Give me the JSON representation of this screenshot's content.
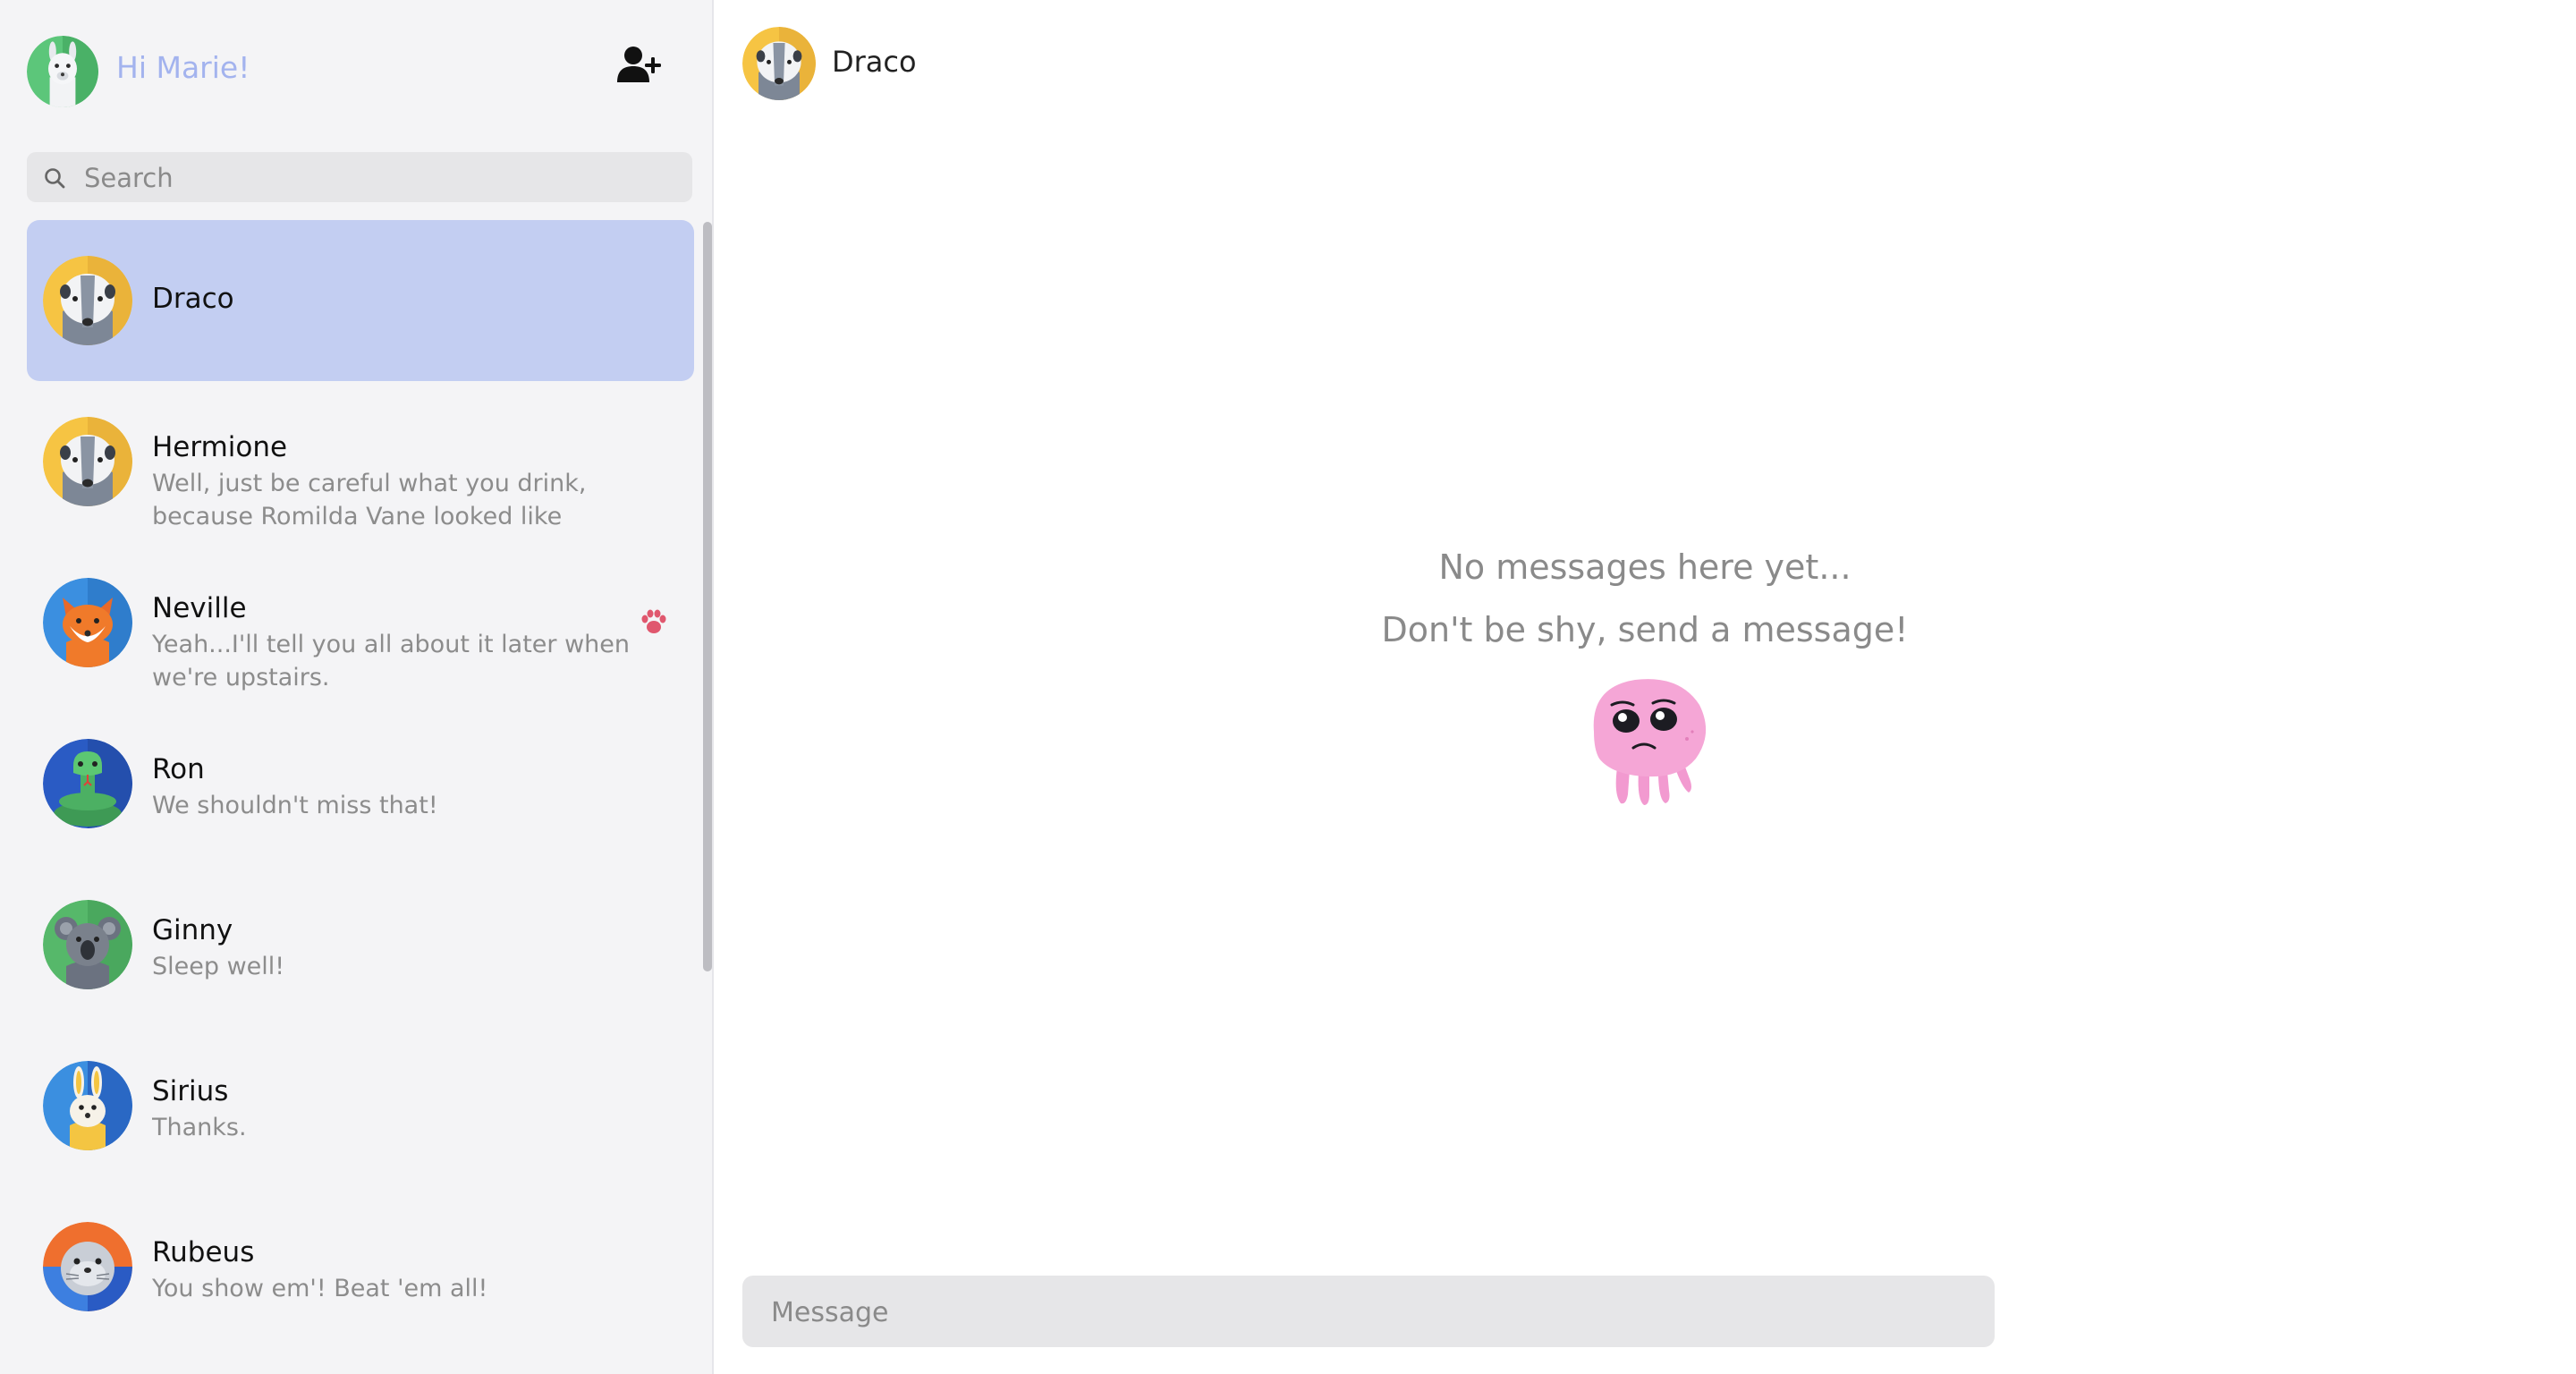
{
  "user": {
    "greeting": "Hi Marie!",
    "avatar_icon": "llama-avatar"
  },
  "sidebar": {
    "add_user_icon": "user-plus-icon",
    "search": {
      "placeholder": "Search",
      "icon": "search-icon"
    },
    "chats": [
      {
        "name": "Draco",
        "preview": "",
        "avatar_icon": "badger-avatar",
        "active": true
      },
      {
        "name": "Hermione",
        "preview": "Well, just be careful what you drink, because Romilda Vane looked like she...",
        "avatar_icon": "badger-avatar"
      },
      {
        "name": "Neville",
        "preview": "Yeah...I'll tell you all about it later when we're upstairs.",
        "avatar_icon": "fox-avatar",
        "unread_icon": "paw-icon"
      },
      {
        "name": "Ron",
        "preview": "We shouldn't miss that!",
        "avatar_icon": "snake-avatar"
      },
      {
        "name": "Ginny",
        "preview": "Sleep well!",
        "avatar_icon": "koala-avatar"
      },
      {
        "name": "Sirius",
        "preview": "Thanks.",
        "avatar_icon": "rabbit-avatar"
      },
      {
        "name": "Rubeus",
        "preview": "You show em'! Beat 'em all!",
        "avatar_icon": "seal-avatar"
      }
    ]
  },
  "conversation": {
    "name": "Draco",
    "avatar_icon": "badger-avatar",
    "empty_title": "No messages here yet...",
    "empty_subtitle": "Don't be shy, send a message!",
    "empty_illustration": "sad-jellyfish-illustration",
    "composer_placeholder": "Message"
  },
  "colors": {
    "accent": "#a3b3ee",
    "active_chat": "#c3cef2",
    "sidebar_bg": "#f4f4f6",
    "input_bg": "#e6e6e8",
    "paw": "#e0576e"
  }
}
